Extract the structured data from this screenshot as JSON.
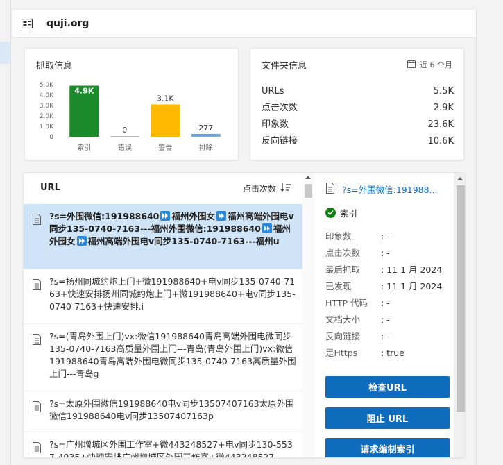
{
  "header": {
    "site": "quji.org"
  },
  "crawl_card": {
    "title": "抓取信息"
  },
  "chart_data": {
    "type": "bar",
    "categories": [
      "索引",
      "错误",
      "警告",
      "排除"
    ],
    "values": [
      4900,
      0,
      3100,
      277
    ],
    "value_labels": [
      "4.9K",
      "0",
      "3.1K",
      "277"
    ],
    "y_ticks": [
      "5.0K",
      "4.0K",
      "3.0K",
      "2.0K",
      "1.0K",
      "0"
    ],
    "ylim": [
      0,
      5000
    ],
    "colors": [
      "#1b8a2a",
      "#c0c0c0",
      "#ffb900",
      "#74a9e0"
    ]
  },
  "folder_card": {
    "title": "文件夹信息",
    "date_range": "近 6 个月",
    "rows": [
      {
        "label": "URLs",
        "value": "5.5K"
      },
      {
        "label": "点击次数",
        "value": "2.9K"
      },
      {
        "label": "印象数",
        "value": "23.6K"
      },
      {
        "label": "反向链接",
        "value": "10.6K"
      }
    ]
  },
  "url_list": {
    "header": "URL",
    "sort_label": "点击次数",
    "items": [
      {
        "parts": [
          "?s=外围微信:191988640",
          "ff",
          "福州外围女",
          "ff",
          "福州高端外围电v同步135-0740-7163---福州外围微信:191988640",
          "ff",
          "福州外围女",
          "ff",
          "福州高端外围电v同步135-0740-7163---福州u"
        ]
      },
      {
        "parts": [
          "?s=扬州同城约炮上门+微191988640+电v同步135-0740-7163+快速安排扬州同城约炮上门+微191988640+电v同步135-0740-7163+快速安排.i"
        ]
      },
      {
        "parts": [
          "?s=(青岛外围上门)vx:微信191988640青岛高端外围电微同步135-0740-7163高质量外围上门---青岛(青岛外围上门)vx:微信191988640青岛高端外围电微同步135-0740-7163高质量外围上门---青岛g"
        ]
      },
      {
        "parts": [
          "?s=太原外围微信191988640电v同步13507407163太原外围微信191988640电v同步13507407163p"
        ]
      },
      {
        "parts": [
          "?s=广州增城区外围工作室+微443248527+电v同步130-5537-4035+快速安排广州增城区外围工作室+微443248527"
        ]
      }
    ]
  },
  "detail": {
    "url": "?s=外围微信:191988...",
    "status": "索引",
    "rows": [
      {
        "k": "印象数",
        "v": ": -"
      },
      {
        "k": "点击次数",
        "v": ": -"
      },
      {
        "k": "最后抓取",
        "v": ": 11 1 月 2024"
      },
      {
        "k": "已发现",
        "v": ": 11 1 月 2024"
      },
      {
        "k": "HTTP 代码",
        "v": ": -"
      },
      {
        "k": "文档大小",
        "v": ": -"
      },
      {
        "k": "反向链接",
        "v": ": -"
      },
      {
        "k": "是Https",
        "v": ": true"
      }
    ],
    "buttons": {
      "inspect": "检查URL",
      "block": "阻止 URL",
      "reindex": "请求编制索引"
    }
  }
}
